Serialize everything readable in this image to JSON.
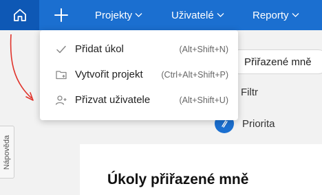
{
  "topbar": {
    "nav": [
      {
        "label": "Projekty"
      },
      {
        "label": "Uživatelé"
      },
      {
        "label": "Reporty"
      }
    ]
  },
  "menu": {
    "items": [
      {
        "label": "Přidat úkol",
        "shortcut": "(Alt+Shift+N)",
        "icon": "check-icon"
      },
      {
        "label": "Vytvořit projekt",
        "shortcut": "(Ctrl+Alt+Shift+P)",
        "icon": "folder-plus-icon"
      },
      {
        "label": "Přizvat uživatele",
        "shortcut": "(Alt+Shift+U)",
        "icon": "user-plus-icon"
      }
    ]
  },
  "background": {
    "assigned_pill": "Přiřazené mně",
    "filter": "Filtr",
    "priority": "Priorita",
    "page_title": "Úkoly přiřazené mně",
    "help_tab": "Nápověda"
  },
  "colors": {
    "topbar": "#1b6fd0",
    "home_active": "#0e58b5",
    "annotation_arrow": "#e0332b"
  }
}
